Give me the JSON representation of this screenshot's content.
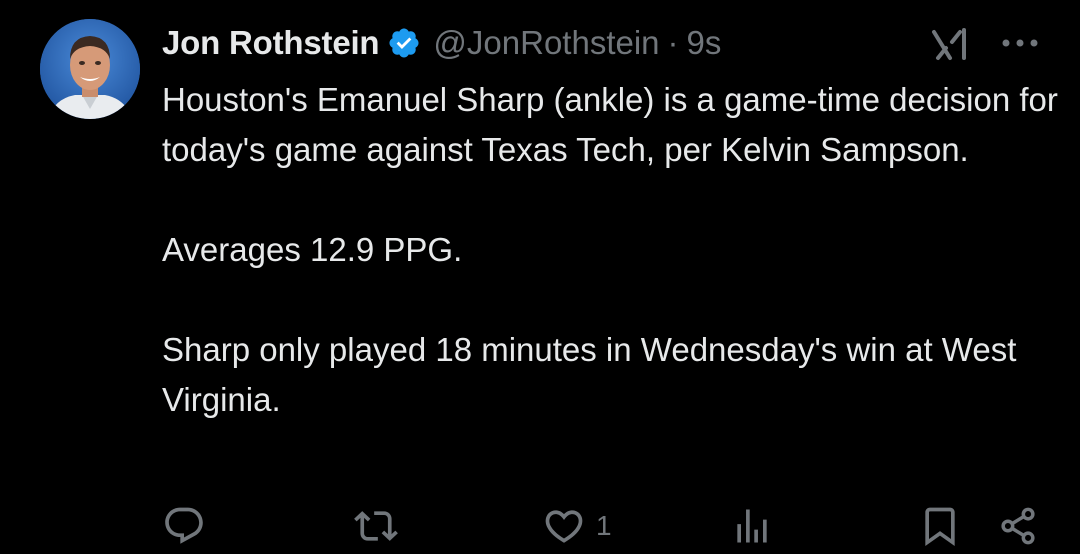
{
  "author": {
    "display_name": "Jon Rothstein",
    "handle": "@JonRothstein",
    "separator": "·",
    "time": "9s",
    "verified": true,
    "verified_color": "#1d9bf0"
  },
  "tweet": {
    "paragraphs": [
      "Houston's Emanuel Sharp (ankle) is a game-time decision for today's game against Texas Tech, per Kelvin Sampson.",
      "Averages 12.9 PPG.",
      "Sharp only played 18 minutes in Wednesday's win at West Virginia."
    ]
  },
  "actions": {
    "reply_icon": "reply-icon",
    "retweet_icon": "retweet-icon",
    "like_icon": "heart-icon",
    "like_count": "1",
    "views_icon": "views-icon",
    "bookmark_icon": "bookmark-icon",
    "share_icon": "share-icon"
  },
  "colors": {
    "background": "#000000",
    "text": "#e7e9ea",
    "muted": "#71767b",
    "accent": "#1d9bf0"
  }
}
